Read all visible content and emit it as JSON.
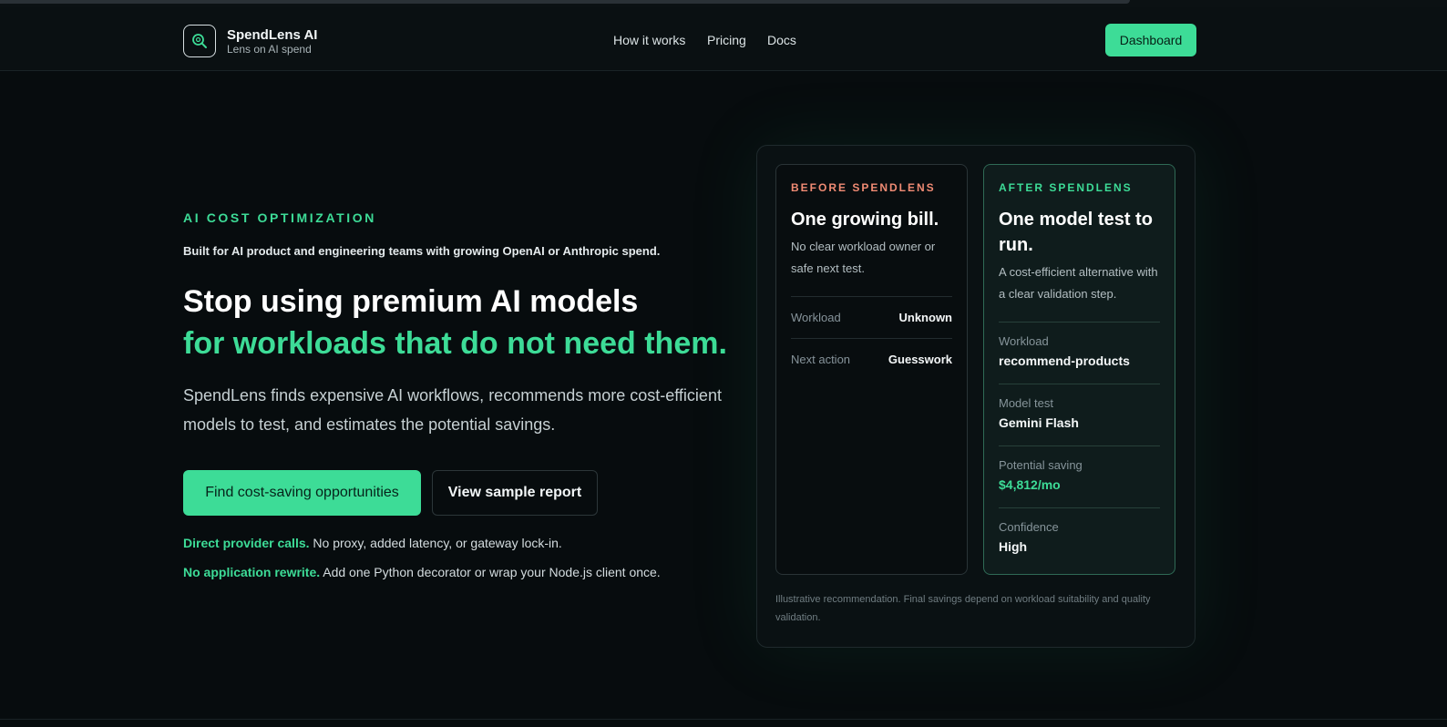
{
  "brand": {
    "name": "SpendLens AI",
    "tagline": "Lens on AI spend",
    "logo_icon": "search-icon"
  },
  "nav": {
    "items": [
      "How it works",
      "Pricing",
      "Docs"
    ],
    "dashboard_label": "Dashboard"
  },
  "hero": {
    "eyebrow": "AI COST OPTIMIZATION",
    "built_for": "Built for AI product and engineering teams with growing OpenAI or Anthropic spend.",
    "headline_line1": "Stop using premium AI models",
    "headline_line2": "for workloads that do not need them.",
    "lede": "SpendLens finds expensive AI workflows, recommends more cost-efficient models to test, and estimates the potential savings.",
    "cta_primary": "Find cost-saving opportunities",
    "cta_secondary": "View sample report",
    "notes": [
      {
        "strong": "Direct provider calls.",
        "text": " No proxy, added latency, or gateway lock-in."
      },
      {
        "strong": "No application rewrite.",
        "text": " Add one Python decorator or wrap your Node.js client once."
      }
    ]
  },
  "comparison": {
    "before": {
      "eyebrow": "BEFORE SPENDLENS",
      "title": "One growing bill.",
      "desc": "No clear workload owner or safe next test.",
      "rows": [
        {
          "label": "Workload",
          "value": "Unknown"
        },
        {
          "label": "Next action",
          "value": "Guesswork"
        }
      ]
    },
    "after": {
      "eyebrow": "AFTER SPENDLENS",
      "title": "One model test to run.",
      "desc": "A cost-efficient alternative with a clear validation step.",
      "rows": [
        {
          "label": "Workload",
          "value": "recommend-products"
        },
        {
          "label": "Model test",
          "value": "Gemini Flash"
        },
        {
          "label": "Potential saving",
          "value": "$4,812/mo"
        },
        {
          "label": "Confidence",
          "value": "High"
        }
      ]
    },
    "disclaimer": "Illustrative recommendation. Final savings depend on workload suitability and quality validation."
  },
  "colors": {
    "accent": "#3ddc97",
    "background": "#070c0e",
    "before_accent": "#f08b74"
  }
}
